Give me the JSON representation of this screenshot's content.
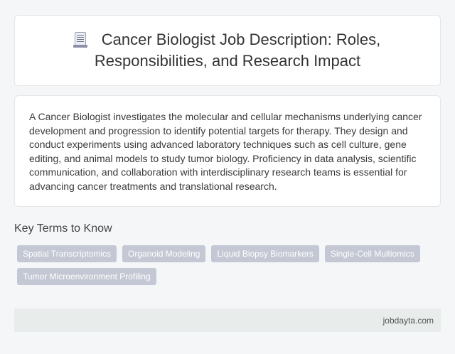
{
  "header": {
    "icon": "document-icon",
    "title": "Cancer Biologist Job Description: Roles, Responsibilities, and Research Impact"
  },
  "description": "A Cancer Biologist investigates the molecular and cellular mechanisms underlying cancer development and progression to identify potential targets for therapy. They design and conduct experiments using advanced laboratory techniques such as cell culture, gene editing, and animal models to study tumor biology. Proficiency in data analysis, scientific communication, and collaboration with interdisciplinary research teams is essential for advancing cancer treatments and translational research.",
  "key_terms": {
    "heading": "Key Terms to Know",
    "items": [
      "Spatial Transcriptomics",
      "Organoid Modeling",
      "Liquid Biopsy Biomarkers",
      "Single-Cell Multiomics",
      "Tumor Microenvironment Profiling"
    ]
  },
  "footer": {
    "site": "jobdayta.com"
  },
  "colors": {
    "background": "#f5f6f8",
    "card": "#ffffff",
    "tag": "#c4c8d4",
    "footer": "#e8eceb"
  }
}
